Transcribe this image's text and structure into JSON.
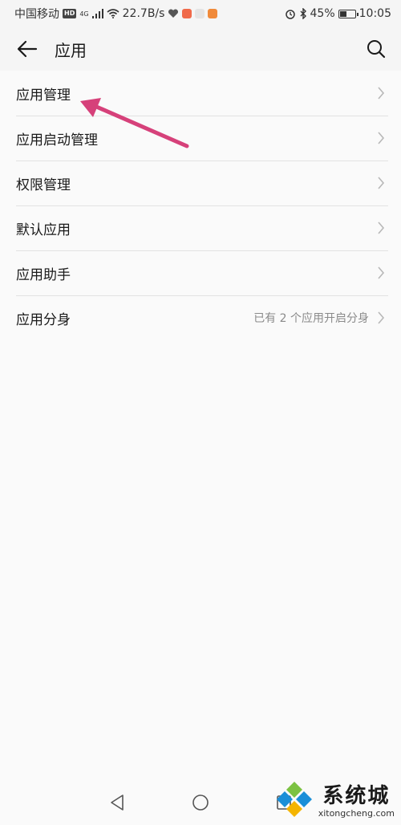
{
  "status_bar": {
    "carrier": "中国移动",
    "hd_badge": "HD",
    "network": "4G",
    "speed": "22.7B/s",
    "battery_percent": "45%",
    "battery_level": 0.45,
    "time": "10:05"
  },
  "header": {
    "title": "应用"
  },
  "list": {
    "items": [
      {
        "label": "应用管理"
      },
      {
        "label": "应用启动管理"
      },
      {
        "label": "权限管理"
      },
      {
        "label": "默认应用"
      },
      {
        "label": "应用助手"
      },
      {
        "label": "应用分身",
        "value": "已有 2 个应用开启分身"
      }
    ]
  },
  "watermark": {
    "title": "系统城",
    "url": "xitongcheng.com"
  },
  "colors": {
    "annotation_arrow": "#d6417a",
    "watermark_blue": "#1a8fd8"
  }
}
